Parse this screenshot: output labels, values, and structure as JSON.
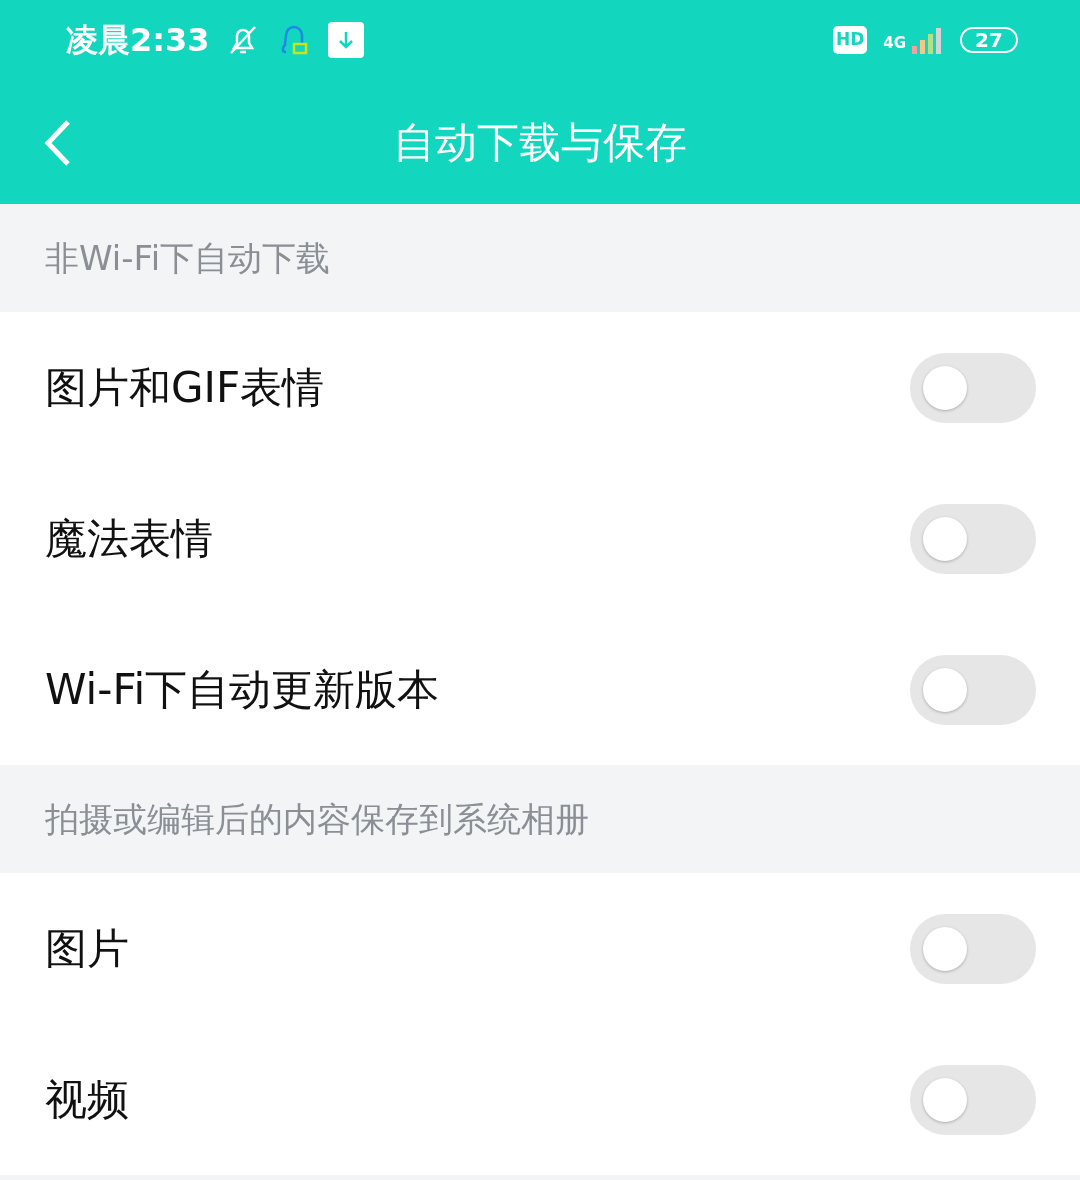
{
  "status_bar": {
    "time": "凌晨2:33",
    "hd_label": "HD",
    "network": "4G",
    "battery": "27"
  },
  "title": "自动下载与保存",
  "sections": [
    {
      "header": "非Wi-Fi下自动下载",
      "items": [
        {
          "label": "图片和GIF表情",
          "on": false
        },
        {
          "label": "魔法表情",
          "on": false
        },
        {
          "label": "Wi-Fi下自动更新版本",
          "on": false
        }
      ]
    },
    {
      "header": "拍摄或编辑后的内容保存到系统相册",
      "items": [
        {
          "label": "图片",
          "on": false
        },
        {
          "label": "视频",
          "on": false
        }
      ]
    }
  ]
}
